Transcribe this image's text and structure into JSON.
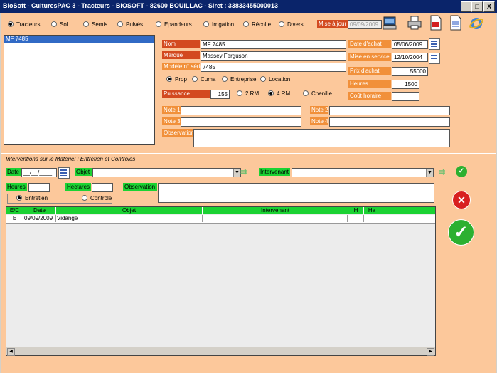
{
  "window": {
    "title": "BioSoft - CulturesPAC 3 - Tracteurs     - BIOSOFT - 82600 BOUILLAC - Siret : 33833455000013"
  },
  "titlebar_buttons": {
    "minimize": "_",
    "maximize": "□",
    "close": "X"
  },
  "nav": {
    "items": [
      "Tracteurs",
      "Sol",
      "Semis",
      "Pulvés",
      "Epandeurs",
      "Irrigation",
      "Récolte",
      "Divers"
    ],
    "selected": 0,
    "update_label": "Mise à jour",
    "update_date": "09/09/2009"
  },
  "toolbar_icons": [
    "computer-icon",
    "printer-icon",
    "pdf-icon",
    "rtf-icon",
    "internet-explorer-icon"
  ],
  "list": {
    "items": [
      "MF 7485"
    ]
  },
  "form": {
    "nom_label": "Nom",
    "nom": "MF 7485",
    "marque_label": "Marque",
    "marque": "Massey Ferguson",
    "modele_label": "Modèle n° série",
    "modele": "7485",
    "ownership": [
      "Prop",
      "Cuma",
      "Entreprise",
      "Location"
    ],
    "ownership_selected": 0,
    "puissance_label": "Puissance",
    "puissance": "155",
    "drive": [
      "2 RM",
      "4 RM",
      "Chenille"
    ],
    "drive_selected": 1,
    "date_achat_label": "Date d'achat",
    "date_achat": "05/06/2009",
    "mise_service_label": "Mise en service",
    "mise_service": "12/10/2004",
    "prix_label": "Prix d'achat",
    "prix": "55000",
    "heures_label": "Heures",
    "heures": "1500",
    "cout_label": "Coût horaire",
    "cout": "",
    "note1_label": "Note 1",
    "note2_label": "Note 2",
    "note3_label": "Note 3",
    "note4_label": "Note 4",
    "observation_label": "Observation"
  },
  "interventions": {
    "section_title": "Interventions sur le Matériel : Entretien et Contrôles",
    "date_label": "Date",
    "date_value": "__/__/____",
    "objet_label": "Objet",
    "intervenant_label": "Intervenant",
    "heures_label": "Heures",
    "hectares_label": "Hectares",
    "observation_label": "Observation",
    "type_options": [
      "Entretien",
      "Contrôle"
    ],
    "type_selected": 0,
    "columns": [
      "E/C",
      "Date",
      "Objet",
      "Intervenant",
      "H",
      "Ha"
    ],
    "rows": [
      [
        "E",
        "09/09/2009",
        "Vidange",
        "",
        "",
        ""
      ]
    ]
  },
  "colors": {
    "background": "#fcc89b",
    "red_label": "#d34a20",
    "orange_label": "#f1903a",
    "green_label": "#1bd233",
    "titlebar": "#0a246a"
  }
}
